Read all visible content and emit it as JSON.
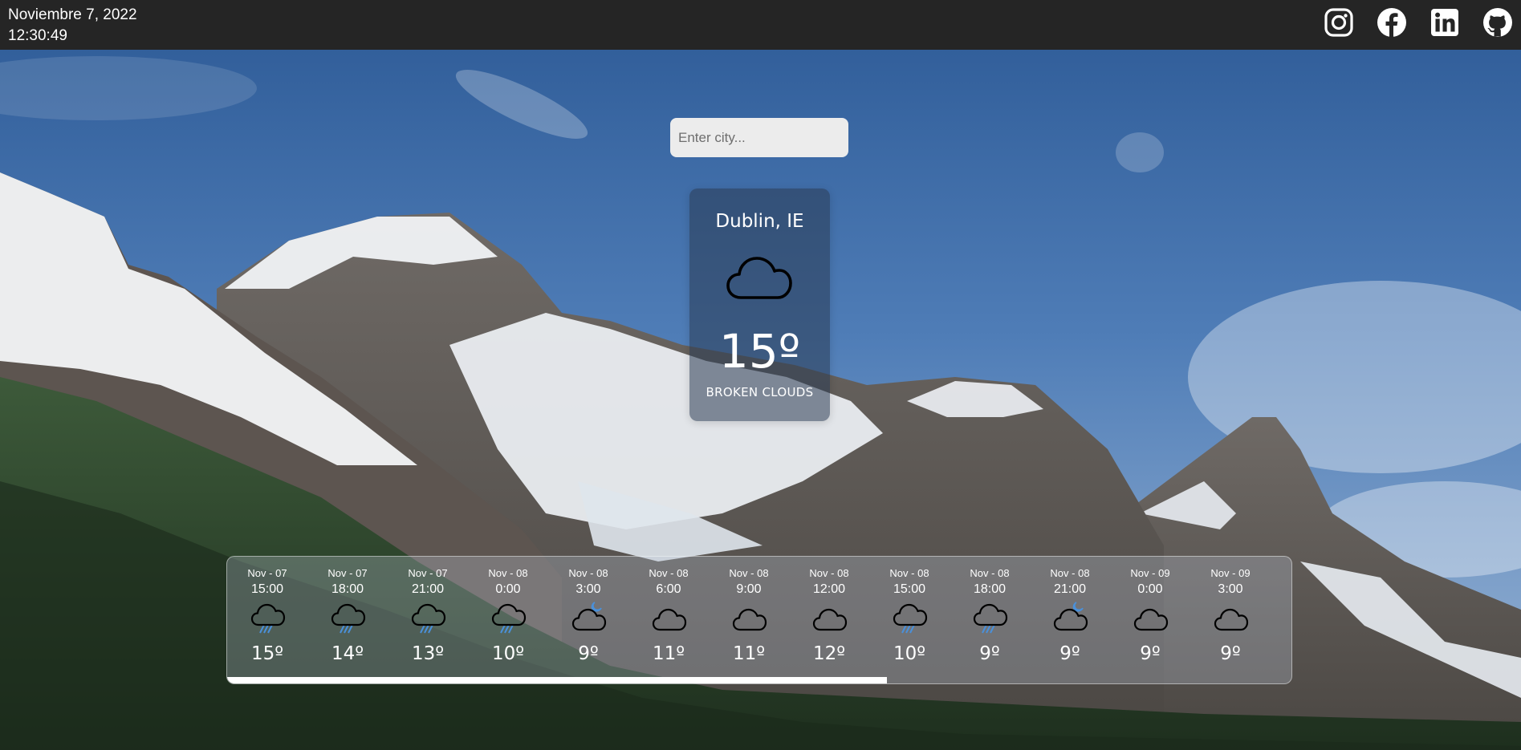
{
  "header": {
    "date": "Noviembre 7, 2022",
    "time": "12:30:49",
    "socials": [
      {
        "name": "instagram",
        "icon": "instagram-icon"
      },
      {
        "name": "facebook",
        "icon": "facebook-icon"
      },
      {
        "name": "linkedin",
        "icon": "linkedin-icon"
      },
      {
        "name": "github",
        "icon": "github-icon"
      }
    ]
  },
  "search": {
    "placeholder": "Enter city...",
    "value": ""
  },
  "current": {
    "city": "Dublin, IE",
    "icon": "cloud-icon",
    "temperature": "15º",
    "description": "BROKEN CLOUDS"
  },
  "forecast": {
    "scroll_fraction": 0.62,
    "items": [
      {
        "date": "Nov - 07",
        "time": "15:00",
        "icon": "rain",
        "temp": "15º"
      },
      {
        "date": "Nov - 07",
        "time": "18:00",
        "icon": "rain",
        "temp": "14º"
      },
      {
        "date": "Nov - 07",
        "time": "21:00",
        "icon": "rain",
        "temp": "13º"
      },
      {
        "date": "Nov - 08",
        "time": "0:00",
        "icon": "rain",
        "temp": "10º"
      },
      {
        "date": "Nov - 08",
        "time": "3:00",
        "icon": "cloud-moon",
        "temp": "9º"
      },
      {
        "date": "Nov - 08",
        "time": "6:00",
        "icon": "cloud",
        "temp": "11º"
      },
      {
        "date": "Nov - 08",
        "time": "9:00",
        "icon": "cloud",
        "temp": "11º"
      },
      {
        "date": "Nov - 08",
        "time": "12:00",
        "icon": "cloud",
        "temp": "12º"
      },
      {
        "date": "Nov - 08",
        "time": "15:00",
        "icon": "rain",
        "temp": "10º"
      },
      {
        "date": "Nov - 08",
        "time": "18:00",
        "icon": "rain",
        "temp": "9º"
      },
      {
        "date": "Nov - 08",
        "time": "21:00",
        "icon": "cloud-moon",
        "temp": "9º"
      },
      {
        "date": "Nov - 09",
        "time": "0:00",
        "icon": "cloud",
        "temp": "9º"
      },
      {
        "date": "Nov - 09",
        "time": "3:00",
        "icon": "cloud",
        "temp": "9º"
      }
    ]
  },
  "colors": {
    "topbar": "#252525",
    "rain_accent": "#4a90d9",
    "moon_accent": "#4a90d9"
  }
}
